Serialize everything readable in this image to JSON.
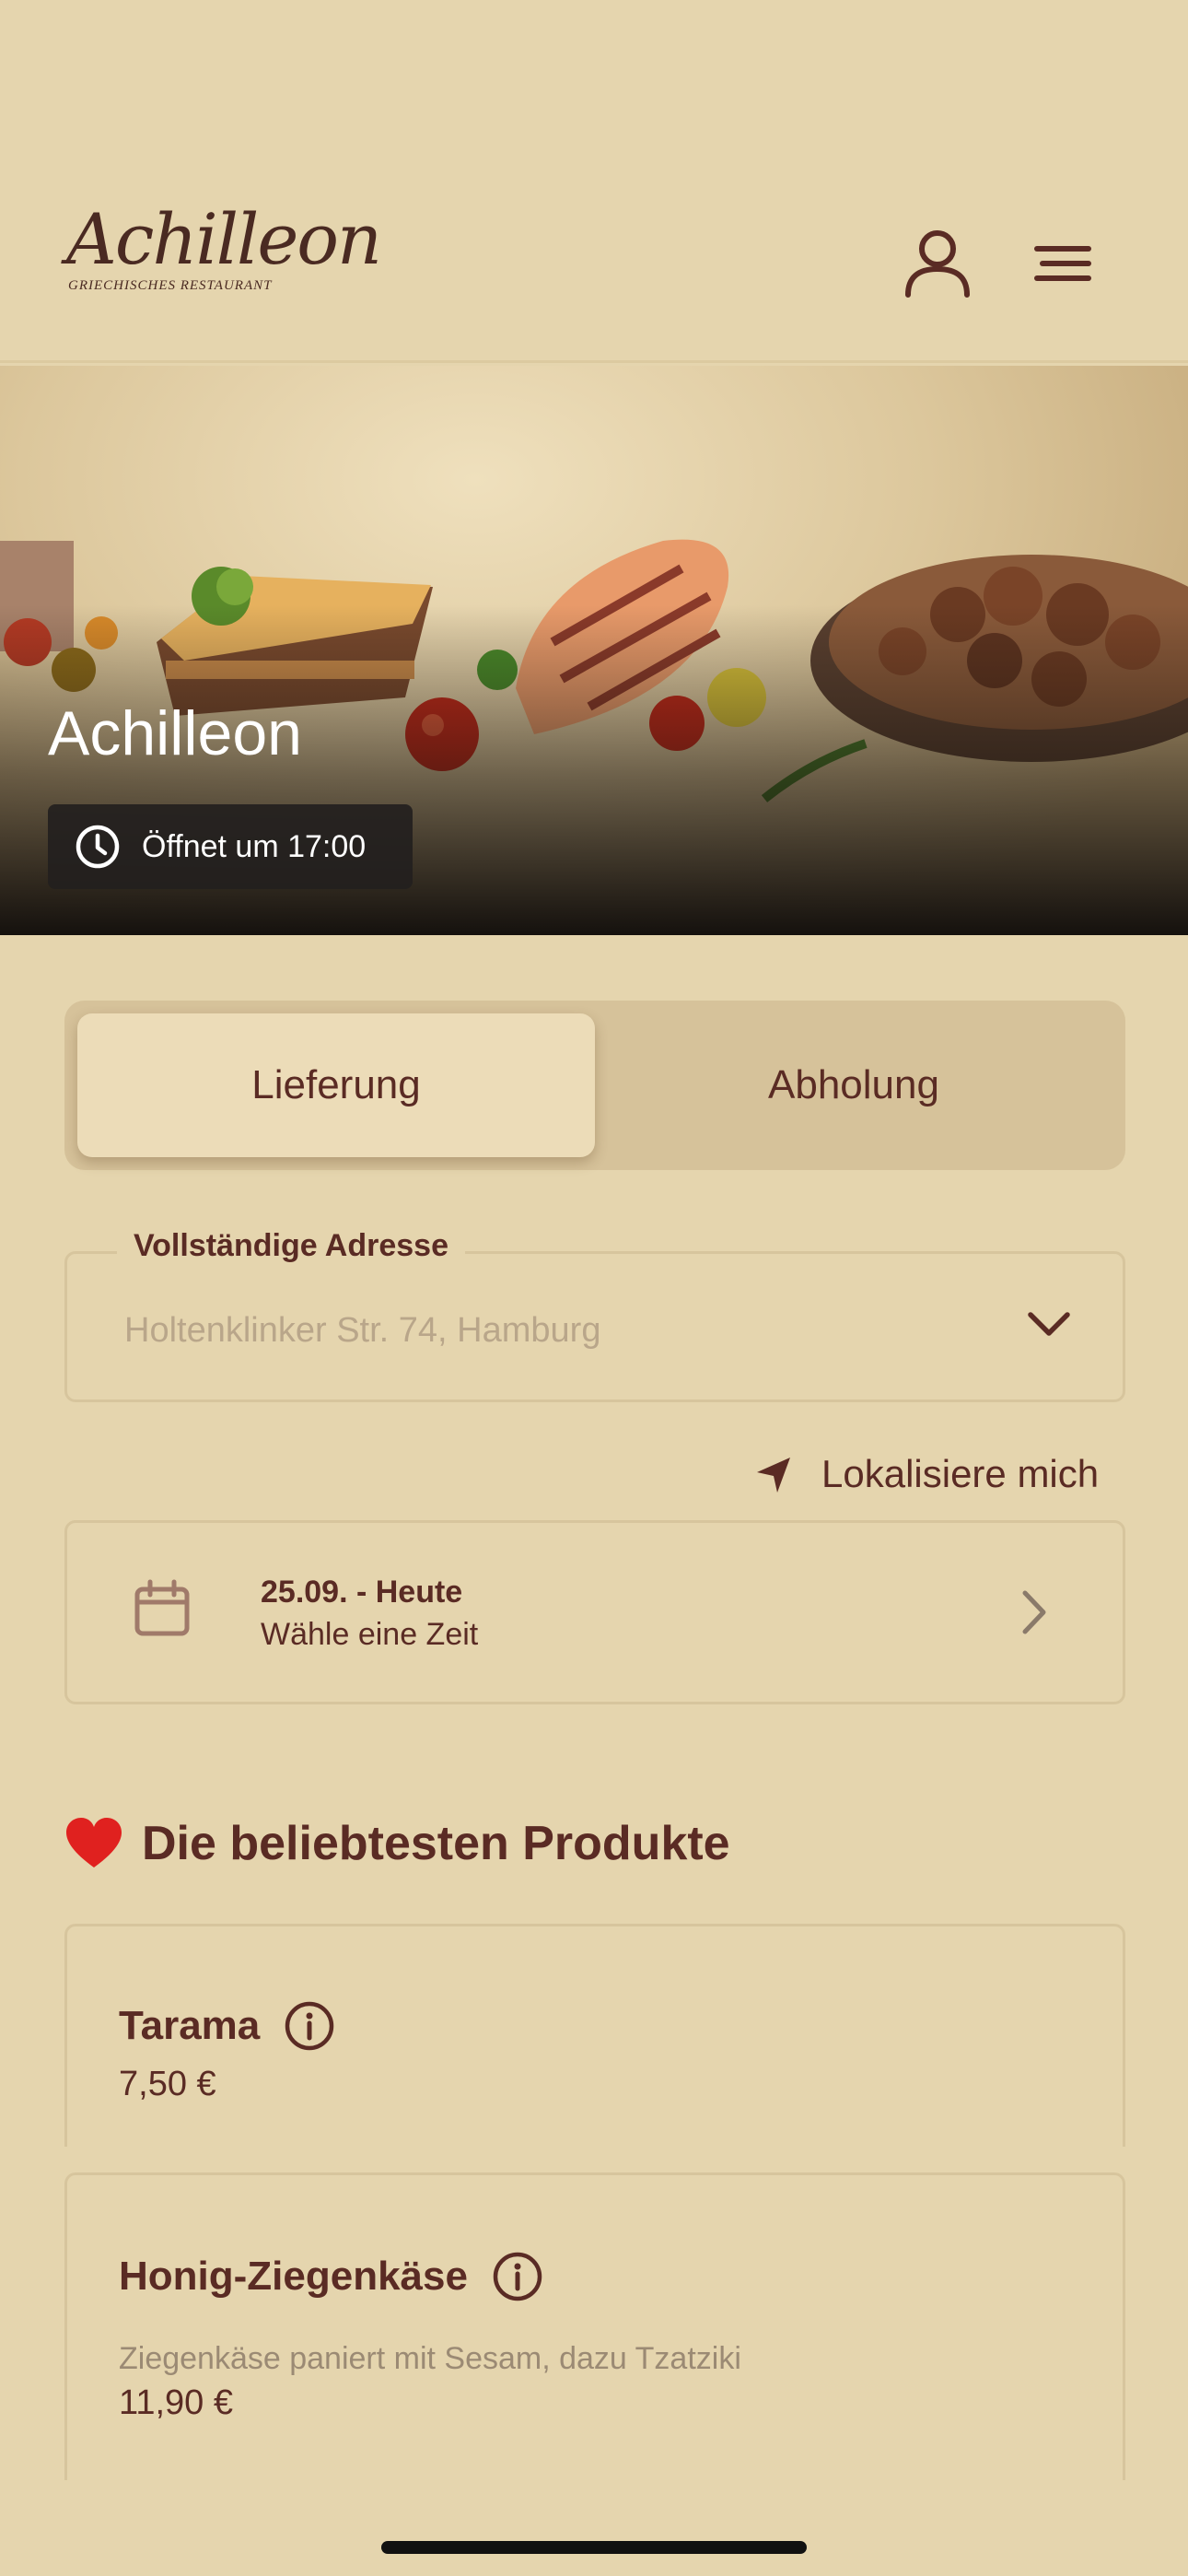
{
  "header": {
    "logo_script": "Achilleon",
    "logo_sub": "GRIECHISCHES RESTAURANT",
    "user_icon": "user-icon",
    "menu_icon": "hamburger-menu-icon"
  },
  "hero": {
    "title": "Achilleon",
    "status": "Öffnet um 17:00",
    "status_icon": "clock-icon"
  },
  "order_mode": {
    "options": [
      "Lieferung",
      "Abholung"
    ],
    "selected": "Lieferung"
  },
  "address": {
    "label": "Vollständige Adresse",
    "placeholder": "Holtenklinker Str. 74, Hamburg",
    "chevron_icon": "chevron-down-icon"
  },
  "locate": {
    "label": "Lokalisiere mich",
    "icon": "location-arrow-icon"
  },
  "date": {
    "title": "25.09. - Heute",
    "subtitle": "Wähle eine Zeit",
    "icon": "calendar-icon",
    "arrow_icon": "chevron-right-icon"
  },
  "popular": {
    "title": "Die beliebtesten Produkte",
    "title_icon": "heart-icon",
    "products": [
      {
        "name": "Tarama",
        "description": "",
        "price": "7,50 €"
      },
      {
        "name": "Honig-Ziegenkäse",
        "description": "Ziegenkäse paniert mit Sesam, dazu Tzatziki",
        "price": "11,90 €"
      }
    ]
  },
  "colors": {
    "background": "#e5d5ae",
    "text_primary": "#5a2b24",
    "toggle_track": "#d6c29a",
    "toggle_active": "#ecdcb8",
    "border": "#d7c59d"
  }
}
